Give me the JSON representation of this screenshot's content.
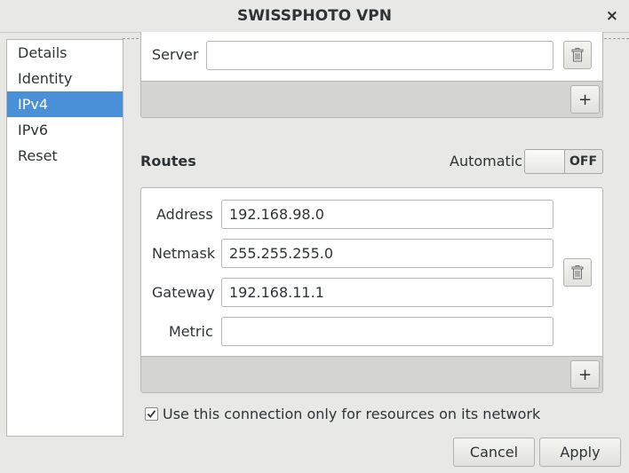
{
  "window": {
    "title": "SWISSPHOTO VPN",
    "close_glyph": "×"
  },
  "sidebar": {
    "items": [
      {
        "label": "Details",
        "selected": false
      },
      {
        "label": "Identity",
        "selected": false
      },
      {
        "label": "IPv4",
        "selected": true
      },
      {
        "label": "IPv6",
        "selected": false
      },
      {
        "label": "Reset",
        "selected": false
      }
    ]
  },
  "dns": {
    "server_label": "Server",
    "server_value": "",
    "add_glyph": "+"
  },
  "routes": {
    "title": "Routes",
    "automatic_label": "Automatic",
    "automatic_state": "OFF",
    "address_label": "Address",
    "address_value": "192.168.98.0",
    "netmask_label": "Netmask",
    "netmask_value": "255.255.255.0",
    "gateway_label": "Gateway",
    "gateway_value": "192.168.11.1",
    "metric_label": "Metric",
    "metric_value": "",
    "add_glyph": "+"
  },
  "only_resources": {
    "checked": true,
    "label": "Use this connection only for resources on its network"
  },
  "actions": {
    "cancel": "Cancel",
    "apply": "Apply"
  },
  "colors": {
    "accent": "#4a90d9",
    "background": "#e8e8e7"
  },
  "icons": {
    "delete": "trash-icon",
    "add": "plus-icon",
    "close": "close-icon",
    "check": "check-icon"
  }
}
